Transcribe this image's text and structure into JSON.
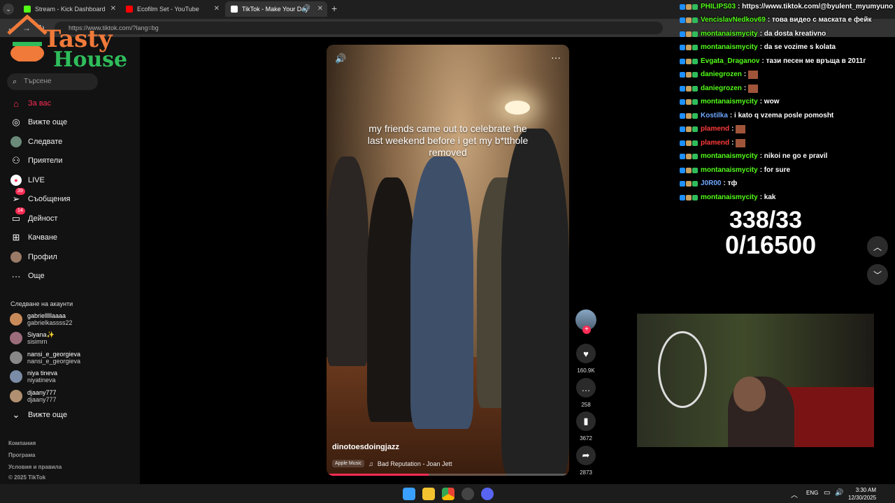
{
  "browser": {
    "tabs": [
      {
        "title": "Stream - Kick Dashboard",
        "favicon_color": "#53fc18"
      },
      {
        "title": "Ecofilm Set - YouTube",
        "favicon_color": "#ff0000"
      },
      {
        "title": "TikTok - Make Your Day",
        "favicon_color": "#ffffff"
      }
    ],
    "url": "https://www.tiktok.com/?lang=bg"
  },
  "logo": {
    "line1": "Tasty",
    "line2": "House"
  },
  "sidebar": {
    "search_placeholder": "Търсене",
    "items": [
      {
        "label": "За вас",
        "icon": "home-icon"
      },
      {
        "label": "Вижте още",
        "icon": "compass-icon"
      },
      {
        "label": "Следвате",
        "icon": "following-avatar-icon"
      },
      {
        "label": "Приятели",
        "icon": "friends-icon"
      },
      {
        "label": "LIVE",
        "icon": "live-icon"
      },
      {
        "label": "Съобщения",
        "icon": "messages-icon",
        "badge": "39"
      },
      {
        "label": "Дейност",
        "icon": "activity-icon",
        "badge": "14"
      },
      {
        "label": "Качване",
        "icon": "upload-icon"
      },
      {
        "label": "Профил",
        "icon": "profile-icon"
      },
      {
        "label": "Още",
        "icon": "more-icon"
      }
    ],
    "following_title": "Следване на акаунти",
    "accounts": [
      {
        "name": "gabrielllllaaaa",
        "handle": "gabrielkassss22",
        "color": "#c98a5a"
      },
      {
        "name": "Siyana✨",
        "handle": "sisimrn",
        "color": "#9b6c7a"
      },
      {
        "name": "nansi_e_georgieva",
        "handle": "nansi_e_georgieva",
        "color": "#888888"
      },
      {
        "name": "niya tineva",
        "handle": "niyatineva",
        "color": "#7a8ca6"
      },
      {
        "name": "djaany777",
        "handle": "djaany777",
        "color": "#b09070"
      }
    ],
    "see_more": "Вижте още",
    "footer": [
      "Компания",
      "Програма",
      "Условия и правила",
      "© 2025 TikTok"
    ]
  },
  "video": {
    "caption": "my friends came out to celebrate the last weekend before i get my b*tthole removed",
    "username": "dinotoesdoingjazz",
    "music_badge": "Apple Music",
    "music": "Bad Reputation - Joan Jett",
    "progress": 0.42
  },
  "actions": {
    "likes": "160.9K",
    "comments": "258",
    "saves": "3672",
    "shares": "2873"
  },
  "chat": [
    {
      "user": "PHILIPS03",
      "color": "#53fc18",
      "text": ": https://www.tiktok.com/@byulent_myumyuno"
    },
    {
      "user": "VencislavNedkov69",
      "color": "#53fc18",
      "text": ": това видео с маската е фейк"
    },
    {
      "user": "montanaismycity",
      "color": "#53fc18",
      "text": ": da dosta kreativno"
    },
    {
      "user": "montanaismycity",
      "color": "#53fc18",
      "text": ": da se vozime s kolata"
    },
    {
      "user": "Evgata_Draganov",
      "color": "#53fc18",
      "text": ": тази песен ме връща в 2011г"
    },
    {
      "user": "daniegrozen",
      "color": "#53fc18",
      "text": ":"
    },
    {
      "user": "daniegrozen",
      "color": "#53fc18",
      "text": ":"
    },
    {
      "user": "montanaismycity",
      "color": "#53fc18",
      "text": ": wow"
    },
    {
      "user": "Kostilka",
      "color": "#6fa8ff",
      "text": ": i kato q vzema posle pomosht"
    },
    {
      "user": "plamend",
      "color": "#ff3b3b",
      "text": ":"
    },
    {
      "user": "plamend",
      "color": "#ff3b3b",
      "text": ":"
    },
    {
      "user": "montanaismycity",
      "color": "#53fc18",
      "text": ": nikoi ne go e pravil"
    },
    {
      "user": "montanaismycity",
      "color": "#53fc18",
      "text": ": for sure"
    },
    {
      "user": "J0R00",
      "color": "#6fa8ff",
      "text": ": тф"
    },
    {
      "user": "montanaismycity",
      "color": "#53fc18",
      "text": ": kak"
    }
  ],
  "counters": {
    "line1": "338/33",
    "line2": "0/16500"
  },
  "taskbar": {
    "lang": "ENG",
    "time": "3:30 AM",
    "date": "12/30/2025"
  }
}
